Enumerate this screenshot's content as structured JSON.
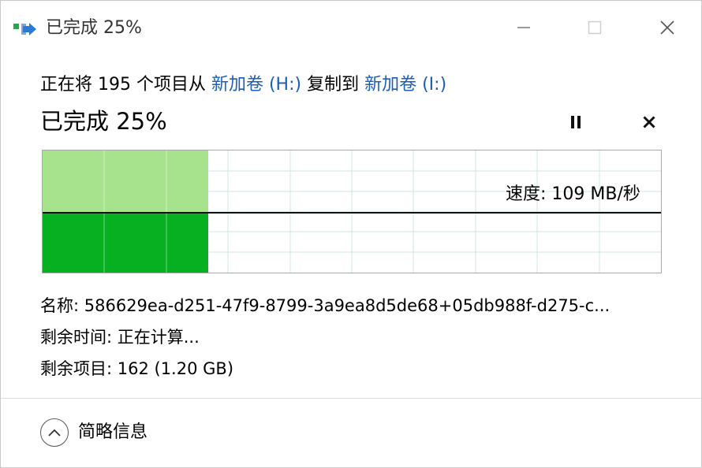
{
  "window": {
    "title": "已完成 25%",
    "icon": "file-copy-icon",
    "buttons": {
      "minimize": "minimize-icon",
      "maximize": "maximize-icon",
      "close": "close-icon"
    }
  },
  "header": {
    "prefix": "正在将 195 个项目从 ",
    "source": "新加卷 (H:)",
    "middle": " 复制到 ",
    "destination": "新加卷 (I:)"
  },
  "status": {
    "text": "已完成 25%",
    "pause_icon": "pause-icon",
    "cancel_icon": "cancel-icon"
  },
  "progress": {
    "percent_complete": 25,
    "speed_label": "速度: 109 MB/秒",
    "colors": {
      "light": "#a6e38c",
      "dark": "#06b021",
      "grid": "#d0e4e0"
    }
  },
  "details": {
    "name": "名称: 586629ea-d251-47f9-8799-3a9ea8d5de68+05db988f-d275-c...",
    "time_remaining": "剩余时间: 正在计算...",
    "items_remaining": "剩余项目: 162 (1.20 GB)"
  },
  "footer": {
    "toggle_label": "简略信息",
    "toggle_icon": "chevron-up-icon"
  }
}
